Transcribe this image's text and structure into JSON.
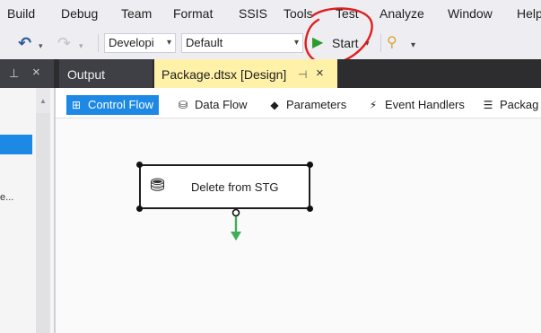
{
  "menu": {
    "items": [
      "Build",
      "Debug",
      "Team",
      "Format",
      "SSIS",
      "Tools",
      "Test",
      "Analyze",
      "Window",
      "Help"
    ]
  },
  "toolbar": {
    "config_combo": "Developi",
    "platform_combo": "Default",
    "start_label": "Start"
  },
  "tabs": {
    "output_label": "Output",
    "package_label": "Package.dtsx [Design]"
  },
  "left_panel": {
    "partial_text": "e..."
  },
  "designer_tabs": {
    "control_flow": "Control Flow",
    "data_flow": "Data Flow",
    "parameters": "Parameters",
    "event_handlers": "Event Handlers",
    "package_explorer": "Packag"
  },
  "canvas": {
    "task_label": "Delete from STG"
  },
  "colors": {
    "accent": "#1e88e5",
    "tab_highlight": "#fff2a8",
    "start_green": "#2e9a2e",
    "annotation_red": "#e01e1e",
    "connector_green": "#3fae5a"
  }
}
